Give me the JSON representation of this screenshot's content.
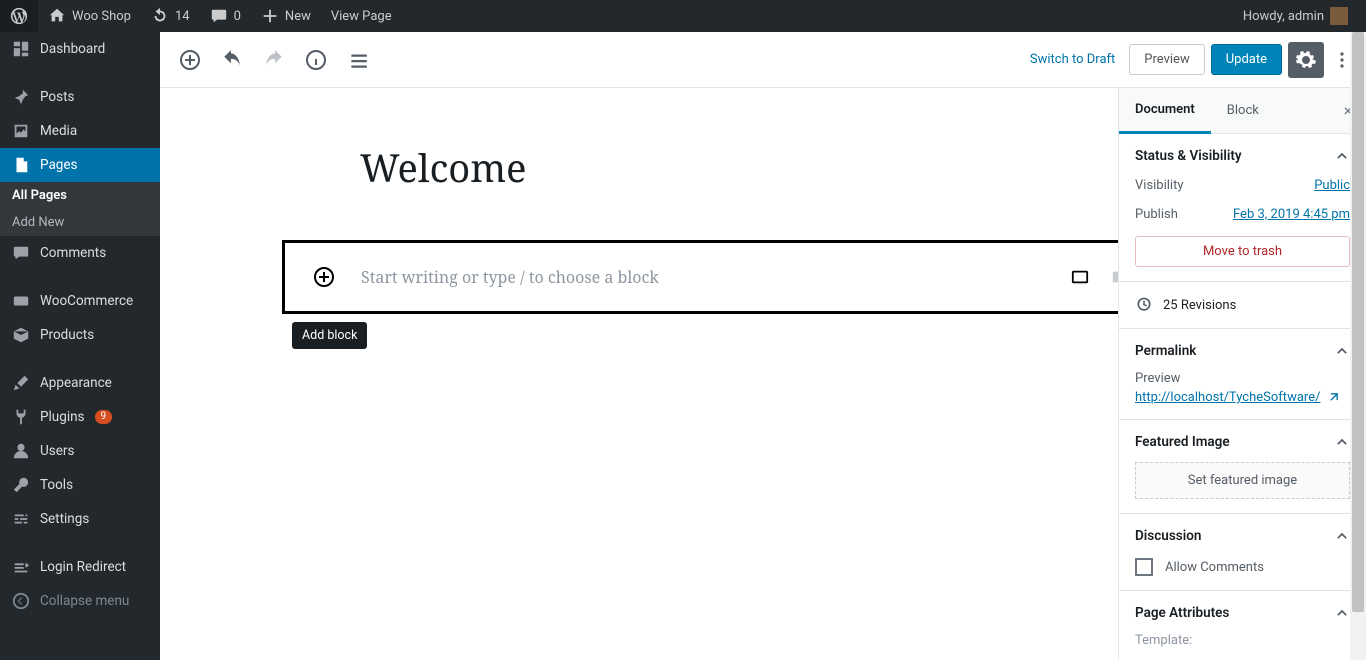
{
  "adminbar": {
    "site_name": "Woo Shop",
    "updates_count": "14",
    "comments_count": "0",
    "new_label": "New",
    "view_page": "View Page",
    "howdy": "Howdy, admin"
  },
  "sidemenu": {
    "items": [
      {
        "label": "Dashboard",
        "icon": "dashboard"
      },
      {
        "label": "Posts",
        "icon": "pin"
      },
      {
        "label": "Media",
        "icon": "media"
      },
      {
        "label": "Pages",
        "icon": "pages",
        "active": true,
        "sub": [
          {
            "label": "All Pages",
            "current": true
          },
          {
            "label": "Add New"
          }
        ]
      },
      {
        "label": "Comments",
        "icon": "comment"
      },
      {
        "label": "WooCommerce",
        "icon": "woo"
      },
      {
        "label": "Products",
        "icon": "box"
      },
      {
        "label": "Appearance",
        "icon": "brush"
      },
      {
        "label": "Plugins",
        "icon": "plug",
        "badge": "9"
      },
      {
        "label": "Users",
        "icon": "user"
      },
      {
        "label": "Tools",
        "icon": "wrench"
      },
      {
        "label": "Settings",
        "icon": "sliders"
      },
      {
        "label": "Login Redirect",
        "icon": "redirect"
      },
      {
        "label": "Collapse menu",
        "icon": "collapse",
        "muted": true
      }
    ]
  },
  "editbar": {
    "switch_draft": "Switch to Draft",
    "preview": "Preview",
    "update": "Update"
  },
  "editor": {
    "title": "Welcome",
    "placeholder": "Start writing or type / to choose a block",
    "tooltip": "Add block"
  },
  "sidebar": {
    "tabs": {
      "document": "Document",
      "block": "Block"
    },
    "status": {
      "title": "Status & Visibility",
      "visibility_label": "Visibility",
      "visibility_value": "Public",
      "publish_label": "Publish",
      "publish_value": "Feb 3, 2019 4:45 pm",
      "trash": "Move to trash"
    },
    "revisions": {
      "count": "25",
      "label": "Revisions"
    },
    "permalink": {
      "title": "Permalink",
      "preview_label": "Preview",
      "url": "http://localhost/TycheSoftware/"
    },
    "featured": {
      "title": "Featured Image",
      "button": "Set featured image"
    },
    "discussion": {
      "title": "Discussion",
      "allow": "Allow Comments"
    },
    "page_attrs": {
      "title": "Page Attributes",
      "template": "Template:"
    }
  }
}
